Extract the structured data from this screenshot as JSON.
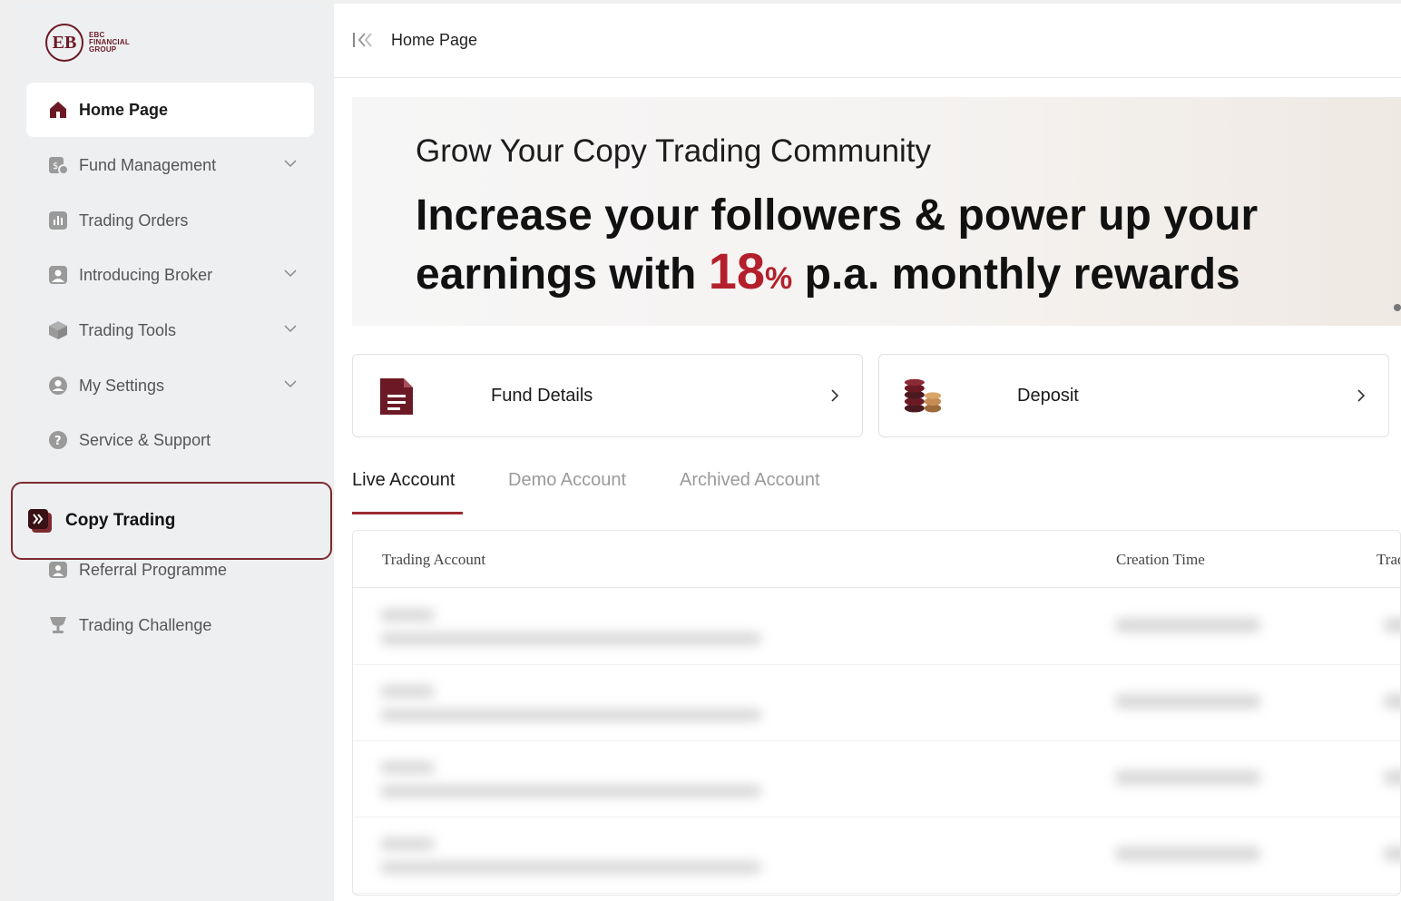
{
  "logo": {
    "mark": "EB",
    "line1": "EBC",
    "line2": "FINANCIAL",
    "line3": "GROUP"
  },
  "sidebar": {
    "items": [
      {
        "label": "Home Page",
        "icon": "home-icon"
      },
      {
        "label": "Fund Management",
        "icon": "fund-icon",
        "expandable": true
      },
      {
        "label": "Trading Orders",
        "icon": "orders-icon"
      },
      {
        "label": "Introducing Broker",
        "icon": "broker-icon",
        "expandable": true
      },
      {
        "label": "Trading Tools",
        "icon": "tools-icon",
        "expandable": true
      },
      {
        "label": "My Settings",
        "icon": "user-icon",
        "expandable": true
      },
      {
        "label": "Service & Support",
        "icon": "help-icon"
      },
      {
        "label": "Copy Trading",
        "icon": "copy-trading-icon"
      },
      {
        "label": "Referral Programme",
        "icon": "referral-icon"
      },
      {
        "label": "Trading Challenge",
        "icon": "trophy-icon"
      }
    ]
  },
  "header": {
    "title": "Home Page"
  },
  "banner": {
    "subtitle": "Grow Your Copy Trading Community",
    "line1": "Increase your followers & power up your",
    "line2_prefix": "earnings with",
    "rate": "18",
    "percent": "%",
    "line2_suffix": "p.a. monthly rewards"
  },
  "cards": [
    {
      "label": "Fund Details",
      "icon": "document-icon"
    },
    {
      "label": "Deposit",
      "icon": "coins-icon"
    }
  ],
  "tabs": [
    {
      "label": "Live Account"
    },
    {
      "label": "Demo Account"
    },
    {
      "label": "Archived Account"
    }
  ],
  "table": {
    "columns": [
      "Trading Account",
      "Creation Time",
      "Trad"
    ]
  },
  "colors": {
    "accent": "#7b2a2f",
    "highlight": "#b3202c",
    "tab_underline": "#9b2c30"
  }
}
